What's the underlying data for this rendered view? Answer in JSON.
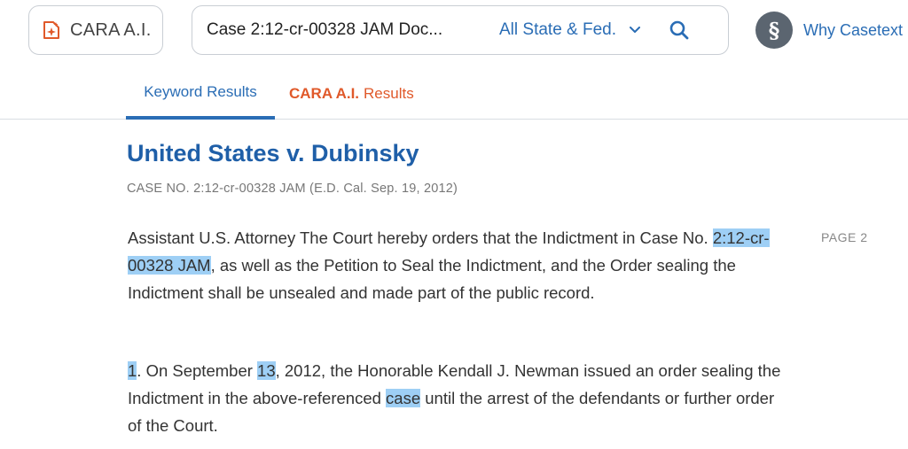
{
  "header": {
    "cara_button_label": "CARA A.I.",
    "search_query": "Case 2:12-cr-00328 JAM Doc...",
    "jurisdiction": "All State & Fed.",
    "why_link": "Why Casetext"
  },
  "tabs": {
    "keyword": "Keyword Results",
    "cara_bold": "CARA A.I.",
    "cara_rest": "Results"
  },
  "result": {
    "title": "United States v. Dubinsky",
    "meta": "CASE NO. 2:12-cr-00328 JAM (E.D. Cal. Sep. 19, 2012)",
    "page_label": "PAGE 2",
    "para1": {
      "a": "Assistant U.S. Attorney The Court hereby orders that the Indictment in Case No. ",
      "highlight": "2:12-cr-00328 JAM",
      "b": ", as well as the Petition to Seal the Indictment, and the Order sealing the Indictment shall be unsealed and made part of the public record."
    },
    "para2": {
      "h1": "1",
      "a": ". On September ",
      "h2": "13",
      "b": ", 2012, the Honorable Kendall J. Newman issued an order sealing the Indictment in the above-referenced ",
      "h3": "case",
      "c": " until the arrest of the defendants or further order of the Court."
    }
  },
  "icons": {
    "cara": "sparkle-document-icon",
    "chevron": "chevron-down-icon",
    "search": "search-icon",
    "section": "section-sign-icon"
  },
  "colors": {
    "brand_blue": "#2a6db5",
    "title_blue": "#1f5fa8",
    "cara_orange": "#e0592a",
    "highlight": "#9ecff5"
  }
}
